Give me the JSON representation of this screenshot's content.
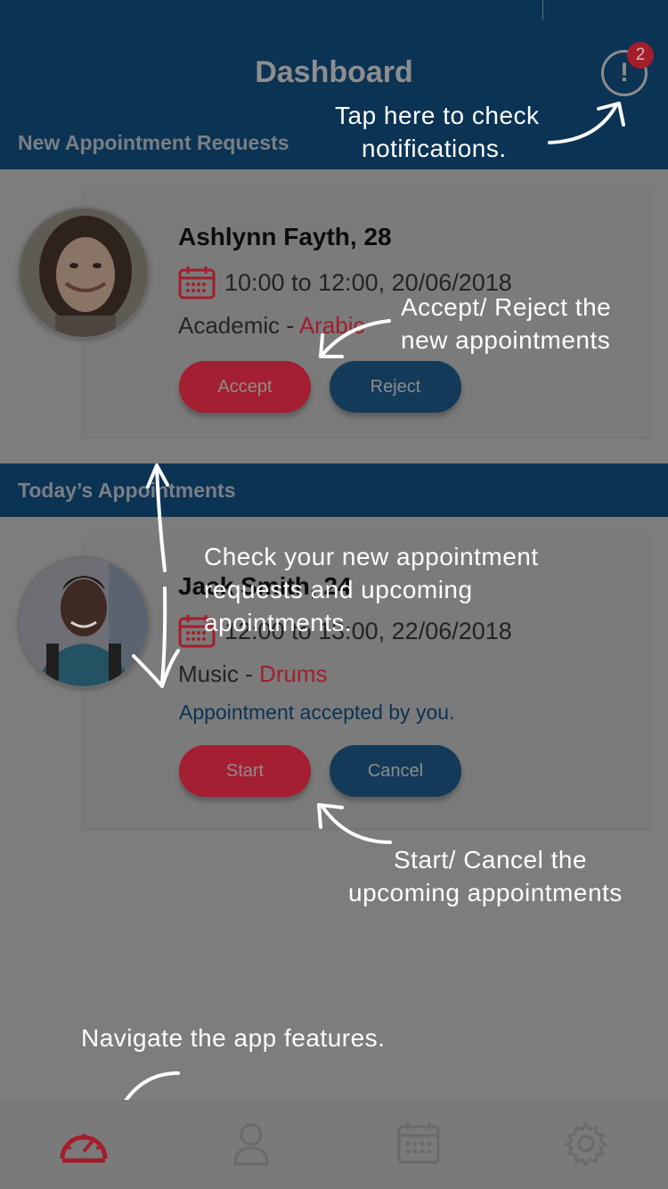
{
  "header": {
    "title": "Dashboard",
    "notification_count": "2"
  },
  "sections": {
    "new_requests_label": "New Appointment Requests",
    "today_label": "Today’s Appointments"
  },
  "request_card": {
    "name": "Ashlynn Fayth, 28",
    "time": "10:00 to 12:00, 20/06/2018",
    "category": "Academic - ",
    "subject": "Arabic",
    "accept_label": "Accept",
    "reject_label": "Reject"
  },
  "today_card": {
    "name": "Jack Smith, 24",
    "time": "12:00 to 13:00, 22/06/2018",
    "category": "Music - ",
    "subject": "Drums",
    "status": "Appointment accepted by you.",
    "start_label": "Start",
    "cancel_label": "Cancel"
  },
  "hints": {
    "notifications_1": "Tap here to check",
    "notifications_2": "notifications.",
    "accept_1": "Accept/ Reject the",
    "accept_2": "new appointments",
    "check_1": "Check your new appointment",
    "check_2": "requests and upcoming",
    "check_3": "apointments.",
    "start_1": "Start/ Cancel the",
    "start_2": "upcoming appointments",
    "navigate": "Navigate the app features."
  },
  "nav": {
    "items": [
      "dashboard",
      "profile",
      "calendar",
      "settings"
    ],
    "active_color": "#a41d2b",
    "inactive_color": "#6a6a6a"
  }
}
